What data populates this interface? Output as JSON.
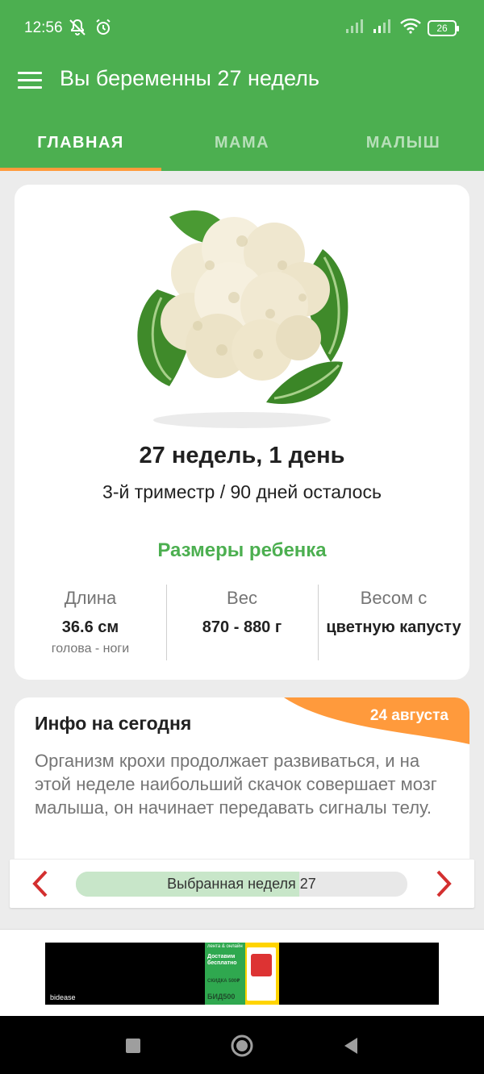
{
  "status_bar": {
    "time": "12:56",
    "battery": "26",
    "icons": [
      "mute-bell-icon",
      "alarm-icon",
      "signal-icon",
      "signal-icon",
      "wifi-icon",
      "battery-icon"
    ]
  },
  "app_bar": {
    "title": "Вы беременны 27 недель",
    "menu_icon": "hamburger-menu-icon"
  },
  "tabs": [
    {
      "label": "ГЛАВНАЯ",
      "active": true
    },
    {
      "label": "МАМА",
      "active": false
    },
    {
      "label": "МАЛЫШ",
      "active": false
    }
  ],
  "colors": {
    "primary": "#4caf50",
    "accent": "#ff9a3c",
    "arrow": "#d32f2f",
    "week_fill": "#c8e6c9"
  },
  "baby_card": {
    "image_icon": "cauliflower-image",
    "week_title": "27 недель, 1 день",
    "trimester": "3-й триместр / 90 дней осталось",
    "sizes_title": "Размеры ребенка",
    "stats": [
      {
        "label": "Длина",
        "value": "36.6 см",
        "sub": "голова - ноги"
      },
      {
        "label": "Вес",
        "value": "870 - 880 г",
        "sub": ""
      },
      {
        "label": "Весом с",
        "value": "цветную капусту",
        "sub": ""
      }
    ]
  },
  "info_card": {
    "title": "Инфо на сегодня",
    "date": "24 августа",
    "body": "Организм крохи продолжает развиваться, и на этой неделе наибольший скачок совершает мозг малыша, он начинает передавать сигналы телу."
  },
  "week_selector": {
    "label": "Выбранная неделя 27",
    "progress": 0.675,
    "prev_icon": "chevron-left-icon",
    "next_icon": "chevron-right-icon"
  },
  "ad": {
    "brand": "bidease",
    "line1": "лента & онлайн",
    "line2": "Доставим бесплатно",
    "line3": "СКИДКА 500₽",
    "code": "БИД500"
  },
  "nav_bar": {
    "icons": [
      "recent-apps-icon",
      "home-icon",
      "back-icon"
    ]
  }
}
